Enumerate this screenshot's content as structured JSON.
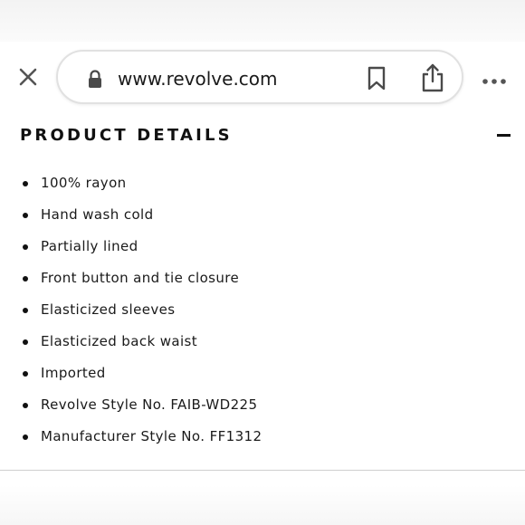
{
  "browser": {
    "url": "www.revolve.com",
    "close_icon": "close-icon",
    "lock_icon": "lock-icon",
    "bookmark_icon": "bookmark-icon",
    "share_icon": "share-icon",
    "more_icon": "more-horizontal-icon"
  },
  "section": {
    "title": "PRODUCT DETAILS",
    "expanded": true,
    "toggle_icon": "minus-icon"
  },
  "details": [
    "100% rayon",
    "Hand wash cold",
    "Partially lined",
    "Front button and tie closure",
    "Elasticized sleeves",
    "Elasticized back waist",
    "Imported",
    "Revolve Style No. FAIB-WD225",
    "Manufacturer Style No. FF1312"
  ]
}
